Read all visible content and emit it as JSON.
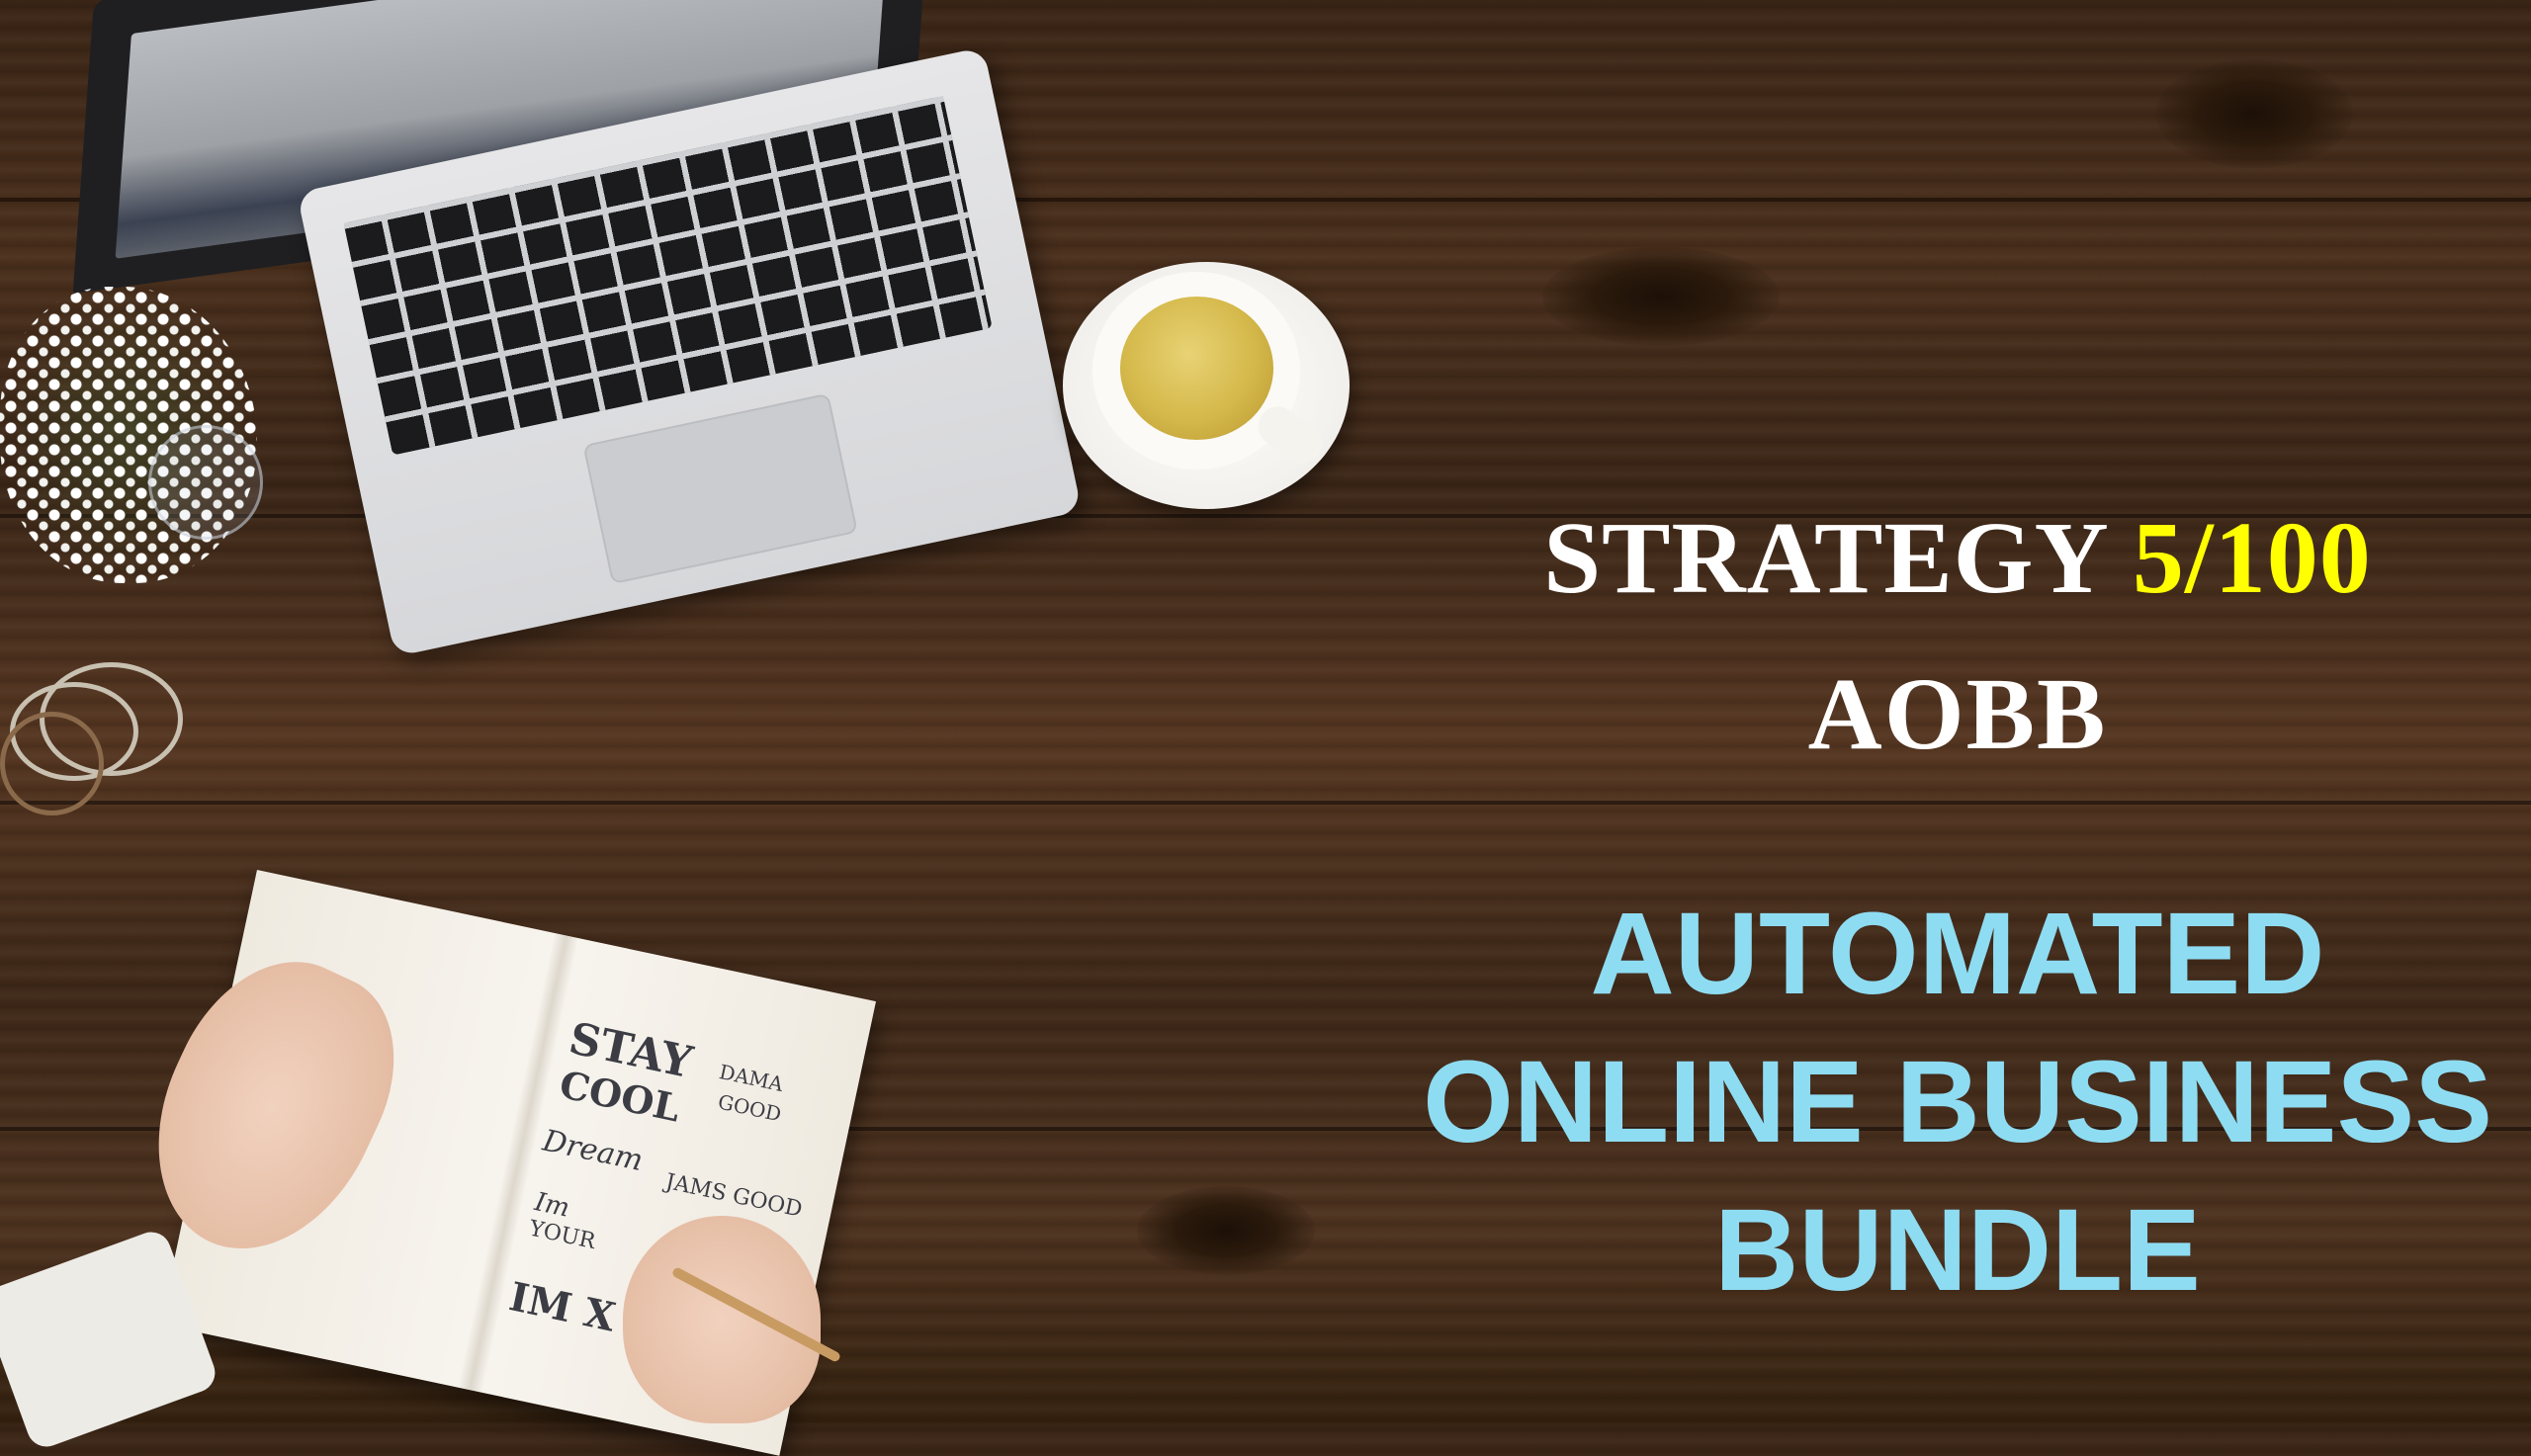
{
  "headline": {
    "strategy_label": "STRATEGY",
    "strategy_number": "5/100",
    "acronym": "AOBB"
  },
  "bundle_title": {
    "line1": "AUTOMATED",
    "line2": "ONLINE BUSINESS",
    "line3": "BUNDLE"
  },
  "notebook_doodles": [
    "STAY",
    "COOL",
    "DAMA",
    "GOOD",
    "Dream",
    "JAMS GOOD",
    "Im",
    "YOUR",
    "IM X"
  ],
  "colors": {
    "headline_text": "#ffffff",
    "strategy_number": "#ffff00",
    "bundle_title": "#8edcf2",
    "wood_background": "#4a2f1c"
  }
}
